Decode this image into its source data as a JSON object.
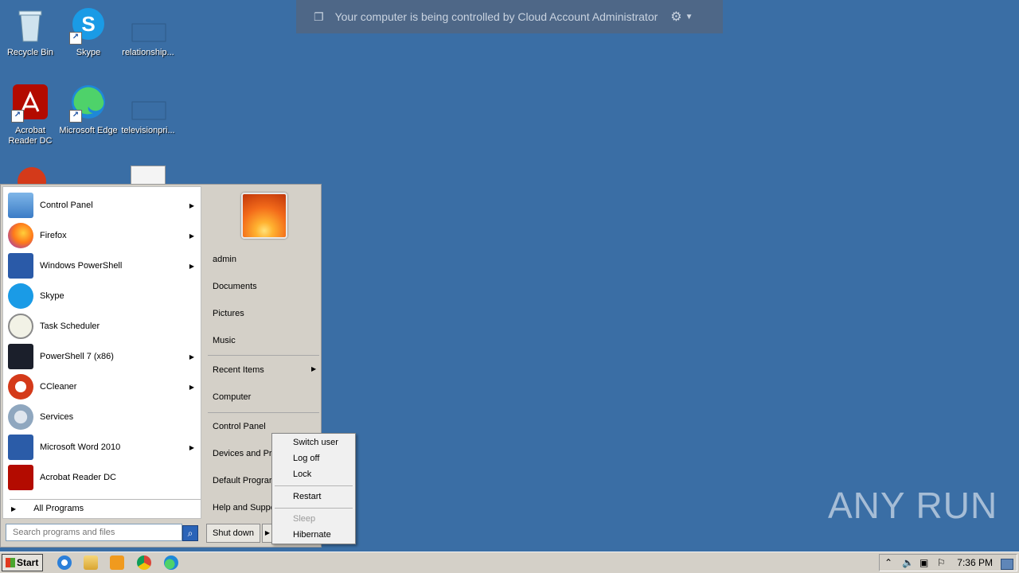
{
  "desktop": {
    "icons": [
      {
        "label": "Recycle Bin"
      },
      {
        "label": "Skype"
      },
      {
        "label": "relationship..."
      },
      {
        "label": "Acrobat Reader DC"
      },
      {
        "label": "Microsoft Edge"
      },
      {
        "label": "televisionpri..."
      }
    ]
  },
  "banner": {
    "message": "Your computer is being controlled by Cloud Account Administrator"
  },
  "start_menu": {
    "programs": [
      {
        "label": "Control Panel",
        "has_submenu": true
      },
      {
        "label": "Firefox",
        "has_submenu": true
      },
      {
        "label": "Windows PowerShell",
        "has_submenu": true
      },
      {
        "label": "Skype",
        "has_submenu": false
      },
      {
        "label": "Task Scheduler",
        "has_submenu": false
      },
      {
        "label": "PowerShell 7 (x86)",
        "has_submenu": true
      },
      {
        "label": "CCleaner",
        "has_submenu": true
      },
      {
        "label": "Services",
        "has_submenu": false
      },
      {
        "label": "Microsoft Word 2010",
        "has_submenu": true
      },
      {
        "label": "Acrobat Reader DC",
        "has_submenu": false
      }
    ],
    "all_programs": "All Programs",
    "search_placeholder": "Search programs and files",
    "places": [
      {
        "label": "admin"
      },
      {
        "label": "Documents"
      },
      {
        "label": "Pictures"
      },
      {
        "label": "Music"
      },
      {
        "label": "Recent Items"
      },
      {
        "label": "Computer"
      },
      {
        "label": "Control Panel"
      },
      {
        "label": "Devices and Pri"
      },
      {
        "label": "Default Prograr"
      },
      {
        "label": "Help and Suppo"
      }
    ],
    "shutdown_label": "Shut down"
  },
  "shutdown_menu": {
    "items": [
      {
        "label": "Switch user"
      },
      {
        "label": "Log off"
      },
      {
        "label": "Lock"
      },
      {
        "label": "Restart"
      },
      {
        "label": "Sleep",
        "disabled": true
      },
      {
        "label": "Hibernate"
      }
    ]
  },
  "watermark": "ANY RUN",
  "taskbar": {
    "start_label": "Start",
    "clock": "7:36 PM"
  }
}
